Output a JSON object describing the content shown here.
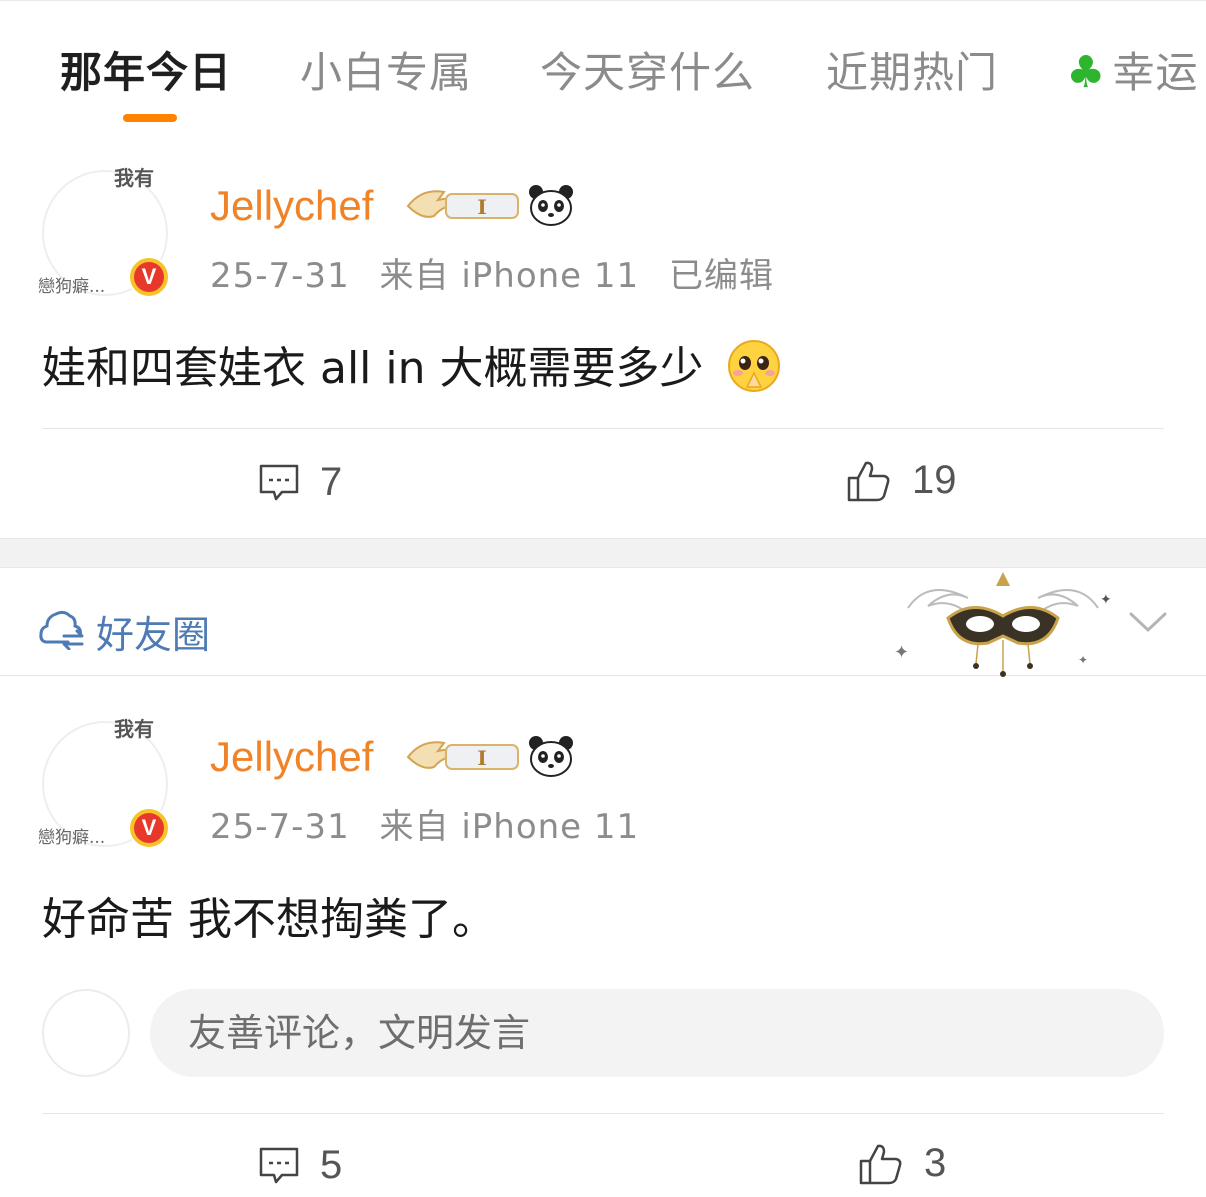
{
  "tabs": [
    {
      "label": "那年今日",
      "active": true
    },
    {
      "label": "小白专属",
      "active": false
    },
    {
      "label": "今天穿什么",
      "active": false
    },
    {
      "label": "近期热门",
      "active": false
    },
    {
      "label": "幸运",
      "active": false,
      "icon": "four-leaf-clover-icon"
    }
  ],
  "accent_color": "#ff8200",
  "posts": [
    {
      "avatar_text_top": "我有",
      "avatar_text_bottom": "戀狗癖...",
      "username": "Jellychef",
      "date": "25-7-31",
      "source": "来自 iPhone 11",
      "edited": "已编辑",
      "content": "娃和四套娃衣 all in 大概需要多少",
      "content_emoji": "pleading-face-icon",
      "comments": "7",
      "likes": "19"
    },
    {
      "avatar_text_top": "我有",
      "avatar_text_bottom": "戀狗癖...",
      "username": "Jellychef",
      "date": "25-7-31",
      "source": "来自 iPhone 11",
      "content": "好命苦 我不想掏粪了。",
      "comments": "5",
      "likes": "3"
    }
  ],
  "friend_circle": {
    "label": "好友圈",
    "icon": "friend-circle-icon"
  },
  "comment_box": {
    "placeholder": "友善评论，文明发言"
  }
}
